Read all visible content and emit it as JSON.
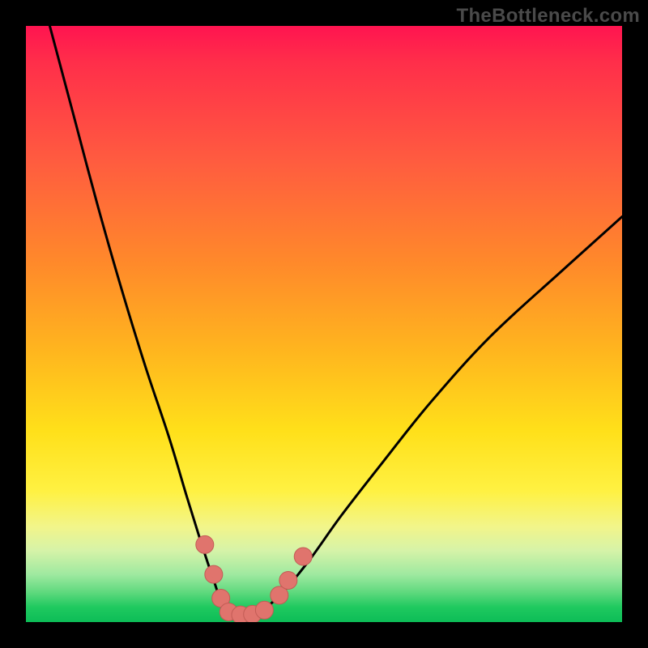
{
  "watermark": "TheBottleneck.com",
  "chart_data": {
    "type": "line",
    "title": "",
    "xlabel": "",
    "ylabel": "",
    "xlim": [
      0,
      100
    ],
    "ylim": [
      0,
      100
    ],
    "series": [
      {
        "name": "bottleneck-curve",
        "x": [
          4,
          8,
          12,
          16,
          20,
          24,
          27,
          29.5,
          31.5,
          33,
          35,
          37,
          39,
          41,
          44,
          48,
          53,
          60,
          68,
          78,
          90,
          100
        ],
        "y": [
          100,
          85,
          70,
          56,
          43,
          31,
          21,
          13,
          7,
          3,
          1,
          1,
          1.5,
          3,
          6,
          11,
          18,
          27,
          37,
          48,
          59,
          68
        ]
      }
    ],
    "markers": [
      {
        "name": "left-cluster-top",
        "x": 30.0,
        "y": 13.0
      },
      {
        "name": "left-cluster-mid",
        "x": 31.5,
        "y": 8.0
      },
      {
        "name": "left-cluster-low",
        "x": 32.7,
        "y": 4.0
      },
      {
        "name": "floor-1",
        "x": 34.0,
        "y": 1.7
      },
      {
        "name": "floor-2",
        "x": 36.0,
        "y": 1.2
      },
      {
        "name": "floor-3",
        "x": 38.0,
        "y": 1.3
      },
      {
        "name": "floor-4",
        "x": 40.0,
        "y": 2.0
      },
      {
        "name": "right-cluster-low",
        "x": 42.5,
        "y": 4.5
      },
      {
        "name": "right-cluster-mid",
        "x": 44.0,
        "y": 7.0
      },
      {
        "name": "right-cluster-top",
        "x": 46.5,
        "y": 11.0
      }
    ],
    "colors": {
      "curve": "#000000",
      "marker_fill": "#e0746d",
      "marker_stroke": "#c25b55"
    }
  }
}
